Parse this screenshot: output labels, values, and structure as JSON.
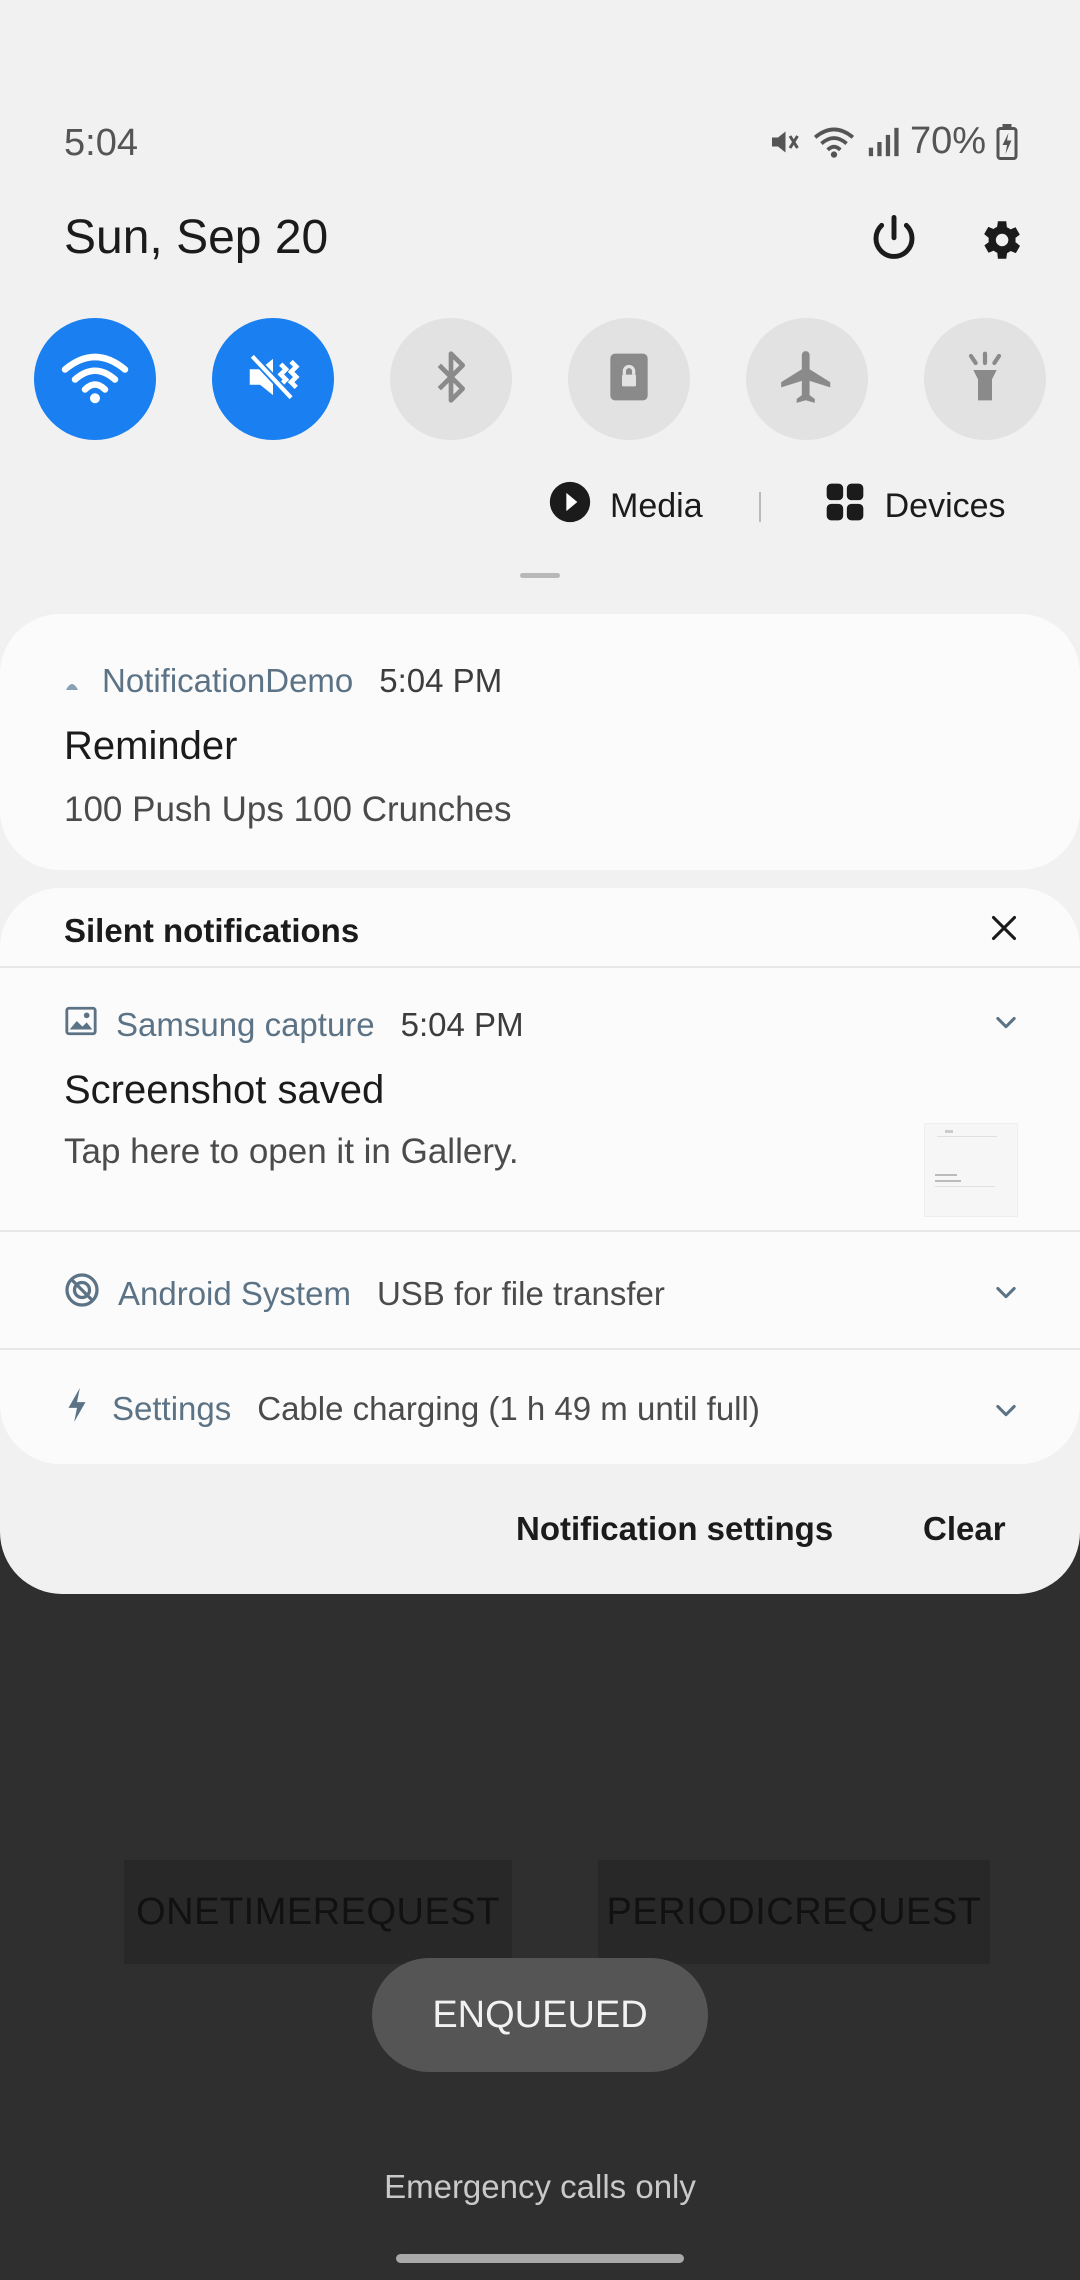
{
  "status_bar": {
    "time": "5:04",
    "battery": "70%",
    "icons": [
      "mute-icon",
      "wifi-icon",
      "signal-icon",
      "battery-charging-icon"
    ]
  },
  "header": {
    "date": "Sun, Sep 20",
    "icons": [
      "power-icon",
      "gear-icon"
    ]
  },
  "quick_settings": [
    {
      "name": "wifi",
      "icon": "wifi-icon",
      "state": "on"
    },
    {
      "name": "sound-mute",
      "icon": "mute-icon",
      "state": "on"
    },
    {
      "name": "bluetooth",
      "icon": "bluetooth-icon",
      "state": "off"
    },
    {
      "name": "rotation-lock",
      "icon": "lock-icon",
      "state": "off"
    },
    {
      "name": "airplane-mode",
      "icon": "airplane-icon",
      "state": "off"
    },
    {
      "name": "flashlight",
      "icon": "flashlight-icon",
      "state": "off"
    }
  ],
  "media_row": {
    "media_label": "Media",
    "devices_label": "Devices"
  },
  "notification_demo": {
    "app": "NotificationDemo",
    "time": "5:04 PM",
    "title": "Reminder",
    "text": "100 Push Ups 100 Crunches"
  },
  "silent": {
    "heading": "Silent notifications",
    "items": [
      {
        "app": "Samsung capture",
        "time": "5:04 PM",
        "title": "Screenshot saved",
        "text": "Tap here to open it in Gallery.",
        "icon": "image-icon"
      },
      {
        "app": "Android System",
        "text": "USB for file transfer",
        "icon": "android-system-icon"
      },
      {
        "app": "Settings",
        "text": "Cable charging (1 h 49 m until full)",
        "icon": "bolt-icon"
      }
    ]
  },
  "footer": {
    "settings_label": "Notification settings",
    "clear_label": "Clear"
  },
  "background_app": {
    "button1": "ONETIMEREQUEST",
    "button2": "PERIODICREQUEST",
    "toast": "ENQUEUED",
    "emergency": "Emergency calls only"
  },
  "colors": {
    "accent": "#1a7ff0",
    "shade_bg": "#f1f1f1",
    "card_bg": "#fbfbfb",
    "app_name": "#5c7386"
  }
}
